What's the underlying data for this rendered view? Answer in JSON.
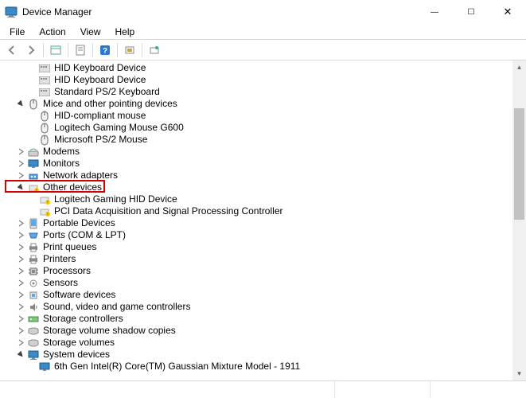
{
  "window": {
    "title": "Device Manager",
    "buttons": {
      "min": "—",
      "max": "☐",
      "close": "✕"
    }
  },
  "menu": {
    "items": [
      "File",
      "Action",
      "View",
      "Help"
    ]
  },
  "toolbar": {
    "icons": [
      "back",
      "forward",
      "up",
      "show-hidden",
      "help",
      "properties",
      "scan"
    ]
  },
  "tree": {
    "r0": {
      "label": "HID Keyboard Device"
    },
    "r1": {
      "label": "HID Keyboard Device"
    },
    "r2": {
      "label": "Standard PS/2 Keyboard"
    },
    "r3": {
      "label": "Mice and other pointing devices"
    },
    "r4": {
      "label": "HID-compliant mouse"
    },
    "r5": {
      "label": "Logitech Gaming Mouse G600"
    },
    "r6": {
      "label": "Microsoft PS/2 Mouse"
    },
    "r7": {
      "label": "Modems"
    },
    "r8": {
      "label": "Monitors"
    },
    "r9": {
      "label": "Network adapters"
    },
    "r10": {
      "label": "Other devices"
    },
    "r11": {
      "label": "Logitech Gaming HID Device"
    },
    "r12": {
      "label": "PCI Data Acquisition and Signal Processing Controller"
    },
    "r13": {
      "label": "Portable Devices"
    },
    "r14": {
      "label": "Ports (COM & LPT)"
    },
    "r15": {
      "label": "Print queues"
    },
    "r16": {
      "label": "Printers"
    },
    "r17": {
      "label": "Processors"
    },
    "r18": {
      "label": "Sensors"
    },
    "r19": {
      "label": "Software devices"
    },
    "r20": {
      "label": "Sound, video and game controllers"
    },
    "r21": {
      "label": "Storage controllers"
    },
    "r22": {
      "label": "Storage volume shadow copies"
    },
    "r23": {
      "label": "Storage volumes"
    },
    "r24": {
      "label": "System devices"
    },
    "r25": {
      "label": "6th Gen Intel(R) Core(TM) Gaussian Mixture Model - 1911"
    }
  }
}
